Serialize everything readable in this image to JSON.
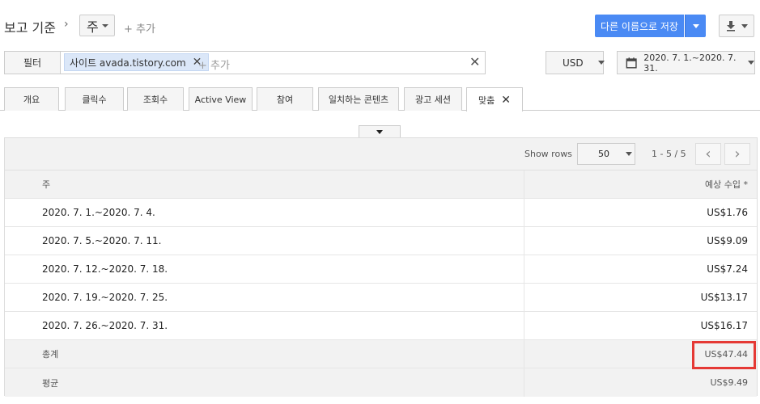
{
  "header": {
    "title": "보고 기준",
    "dimension_value": "주",
    "add_dimension": "+ 추가",
    "save_as_label": "다른 이름으로 저장"
  },
  "filter_bar": {
    "label": "필터",
    "chip_text": "사이트 avada.tistory.com",
    "add_placeholder": "+ 추가"
  },
  "currency": "USD",
  "date_range": "2020. 7. 1.~2020. 7. 31.",
  "tabs": [
    {
      "label": "개요"
    },
    {
      "label": "클릭수"
    },
    {
      "label": "조회수"
    },
    {
      "label": "Active View"
    },
    {
      "label": "참여"
    },
    {
      "label": "일치하는 콘텐츠"
    },
    {
      "label": "광고 세션"
    },
    {
      "label": "맞춤"
    }
  ],
  "table": {
    "show_rows_label": "Show rows",
    "rows_per_page": "50",
    "page_info": "1 - 5 / 5",
    "col_week": "주",
    "col_revenue": "예상 수입 *",
    "rows": [
      {
        "week": "2020. 7. 1.~2020. 7. 4.",
        "revenue": "US$1.76"
      },
      {
        "week": "2020. 7. 5.~2020. 7. 11.",
        "revenue": "US$9.09"
      },
      {
        "week": "2020. 7. 12.~2020. 7. 18.",
        "revenue": "US$7.24"
      },
      {
        "week": "2020. 7. 19.~2020. 7. 25.",
        "revenue": "US$13.17"
      },
      {
        "week": "2020. 7. 26.~2020. 7. 31.",
        "revenue": "US$16.17"
      }
    ],
    "total_label": "총계",
    "total_value": "US$47.44",
    "avg_label": "평균",
    "avg_value": "US$9.49"
  },
  "colors": {
    "primary": "#4a8af4",
    "highlight": "#e53935"
  }
}
